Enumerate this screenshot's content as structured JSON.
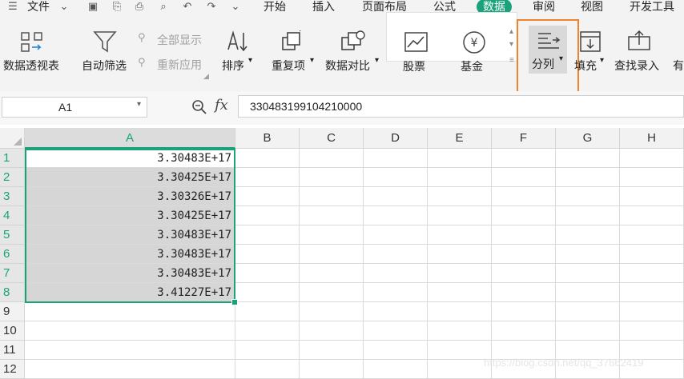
{
  "menu": {
    "file_label": "文件",
    "tabs": [
      "开始",
      "插入",
      "页面布局",
      "公式",
      "数据",
      "审阅",
      "视图",
      "开发工具"
    ],
    "active_tab": "数据"
  },
  "ribbon": {
    "pivot": "数据透视表",
    "autofilter": "自动筛选",
    "show_all": "全部显示",
    "reapply": "重新应用",
    "sort": "排序",
    "duplicates": "重复项",
    "compare": "数据对比",
    "stock": "股票",
    "fund": "基金",
    "split": "分列",
    "fill": "填充",
    "lookup": "查找录入",
    "more": "有"
  },
  "formula_bar": {
    "name_box": "A1",
    "fx_label": "fx",
    "formula": "330483199104210000"
  },
  "columns": [
    "A",
    "B",
    "C",
    "D",
    "E",
    "F",
    "G",
    "H"
  ],
  "rows": [
    "1",
    "2",
    "3",
    "4",
    "5",
    "6",
    "7",
    "8",
    "9",
    "10",
    "11",
    "12"
  ],
  "column_a": [
    "3.30483E+17",
    "3.30425E+17",
    "3.30326E+17",
    "3.30425E+17",
    "3.30483E+17",
    "3.30483E+17",
    "3.30483E+17",
    "3.41227E+17"
  ],
  "watermark": "https://blog.csdn.net/qq_37662419",
  "colors": {
    "accent": "#1aa37a",
    "highlight": "#f0822f"
  }
}
